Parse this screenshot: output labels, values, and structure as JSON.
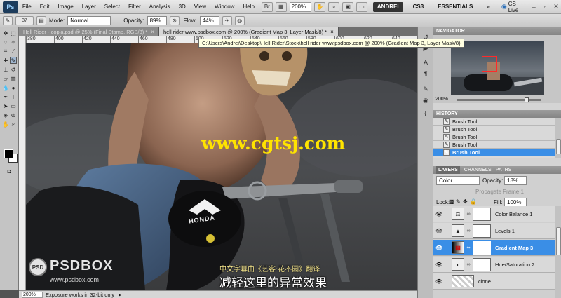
{
  "app": {
    "logo": "Ps",
    "menu": [
      "File",
      "Edit",
      "Image",
      "Layer",
      "Select",
      "Filter",
      "Analysis",
      "3D",
      "View",
      "Window",
      "Help"
    ],
    "zoom": "200%",
    "workspaces": [
      "ANDREI",
      "CS3",
      "ESSENTIALS"
    ],
    "workspace_more": "»",
    "cs_live": "CS Live",
    "window_controls": [
      "–",
      "▫",
      "✕"
    ]
  },
  "options": {
    "brush_size": "37",
    "mode_label": "Mode:",
    "mode_value": "Normal",
    "opacity_label": "Opacity:",
    "opacity_value": "89%",
    "flow_label": "Flow:",
    "flow_value": "44%"
  },
  "tabs": [
    {
      "label": "Hell Rider - copia.psd @ 25% (Final Stamp, RGB/8) *",
      "active": false,
      "close": "×"
    },
    {
      "label": "hell rider www.psdbox.com @ 200% (Gradient Map 3, Layer Mask/8) *",
      "active": true,
      "close": "×"
    }
  ],
  "path_tooltip": "C:\\Users\\Andrei\\Desktop\\Hell Rider\\Stock\\hell rider www.psdbox.com @ 200% (Gradient Map 3, Layer Mask/8)",
  "ruler": {
    "h": [
      "380",
      "400",
      "420",
      "440",
      "460",
      "480",
      "500",
      "520",
      "540",
      "560",
      "580",
      "600",
      "620",
      "640"
    ]
  },
  "canvas": {
    "watermark": "www.cgtsj.com",
    "brand_logo_text": "PSDBOX",
    "brand_logo_badge": "PSD",
    "brand_url": "www.psdbox.com",
    "tank_brand": "HONDA",
    "subtitle_top": "中文字幕由《艺客·花不园》翻译",
    "subtitle_main": "减轻这里的异常效果"
  },
  "status": {
    "zoom": "200%",
    "message": "Exposure works in 32-bit only"
  },
  "navigator": {
    "title": "NAVIGATOR",
    "zoom": "200%"
  },
  "history": {
    "title": "HISTORY",
    "items": [
      {
        "label": "Brush Tool",
        "selected": false
      },
      {
        "label": "Brush Tool",
        "selected": false
      },
      {
        "label": "Brush Tool",
        "selected": false
      },
      {
        "label": "Brush Tool",
        "selected": false
      },
      {
        "label": "Brush Tool",
        "selected": true
      }
    ]
  },
  "layers": {
    "tabs": [
      "LAYERS",
      "CHANNELS",
      "PATHS"
    ],
    "blend_mode": "Color",
    "opacity_label": "Opacity:",
    "opacity_value": "18%",
    "propagate_label": "Propagate Frame 1",
    "lock_label": "Lock:",
    "fill_label": "Fill:",
    "fill_value": "100%",
    "items": [
      {
        "name": "Color Balance 1",
        "icon": "⚖",
        "selected": false
      },
      {
        "name": "Levels 1",
        "icon": "▲",
        "selected": false
      },
      {
        "name": "Gradient Map 3",
        "icon": "▤",
        "selected": true
      },
      {
        "name": "Hue/Saturation 2",
        "icon": "◐",
        "selected": false
      },
      {
        "name": "clone",
        "icon": "",
        "selected": false
      }
    ]
  },
  "colors": {
    "accent": "#3a8ee6",
    "watermark": "#ffe400"
  }
}
